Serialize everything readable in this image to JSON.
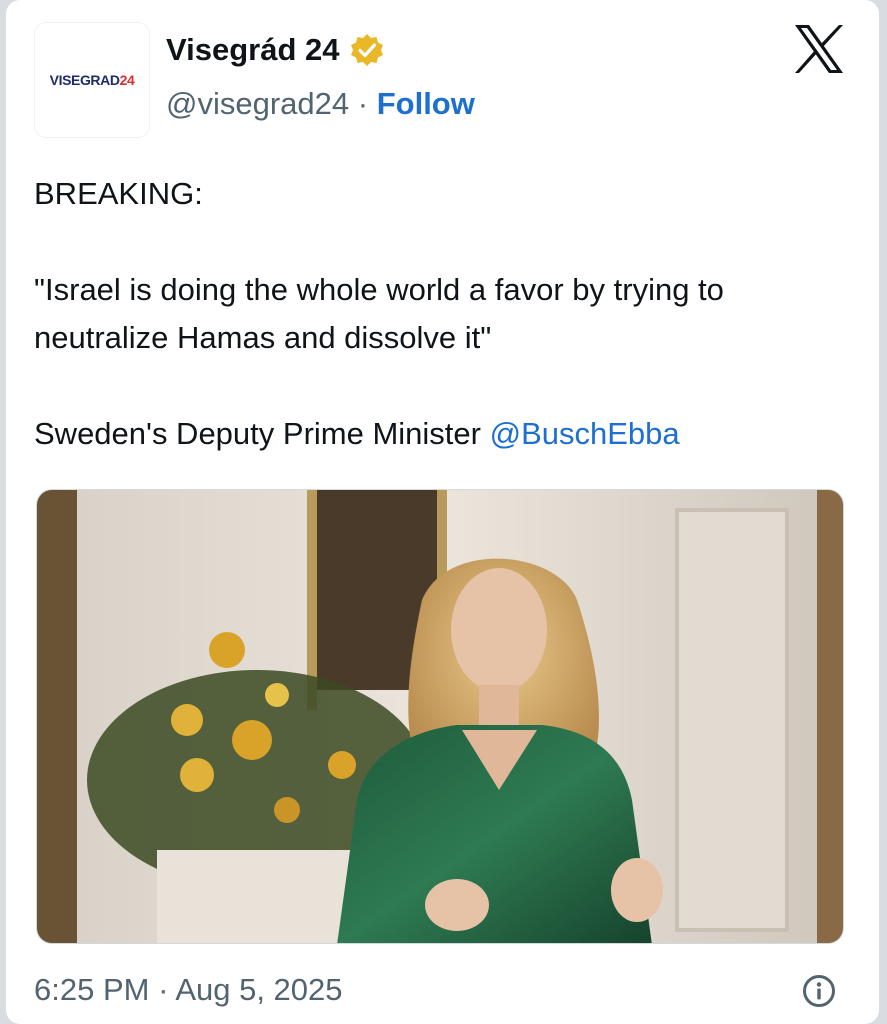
{
  "author": {
    "avatar_logo_text": "VISEGRAD",
    "avatar_logo_number": "24",
    "display_name": "Visegrád 24",
    "handle": "@visegrad24",
    "separator": "·",
    "follow_label": "Follow",
    "verified_icon": "verified-badge-icon"
  },
  "brand_icon": "x-logo-icon",
  "tweet": {
    "line_1": "BREAKING:",
    "line_2": "\"Israel is doing the whole world a favor by trying to neutralize Hamas and dissolve it\"",
    "line_3_prefix": "Sweden's Deputy Prime Minister ",
    "mention": "@BuschEbba"
  },
  "meta": {
    "time": "6:25 PM",
    "separator": "·",
    "date": "Aug 5, 2025",
    "info_icon": "info-icon"
  },
  "colors": {
    "link_blue": "#1d6fd0",
    "verified_gold": "#e8b829",
    "secondary_text": "#536471"
  }
}
